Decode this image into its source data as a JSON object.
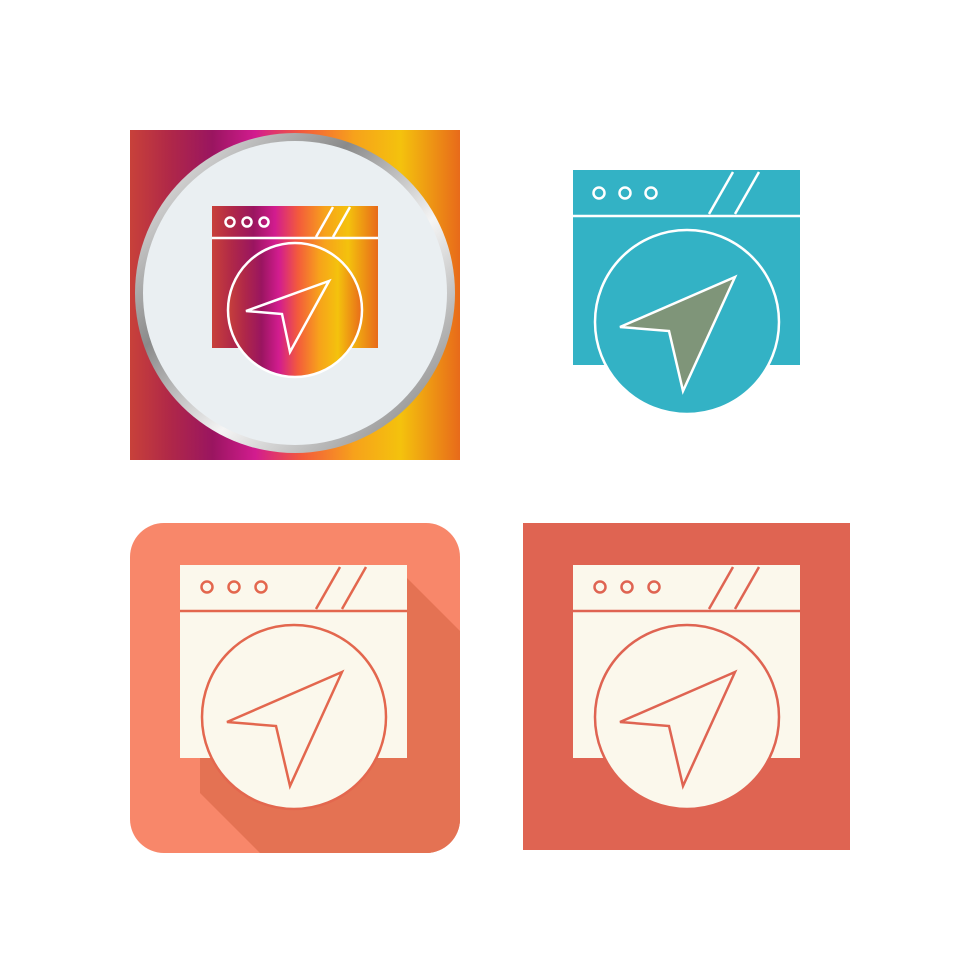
{
  "icons": [
    {
      "name": "browser-navigation-gradient-icon",
      "style": "gradient-circle",
      "colors": {
        "stops": [
          "#c8413a",
          "#9a1560",
          "#d21c8f",
          "#f35a3c",
          "#f7a21b",
          "#f4c20d",
          "#e86a1a"
        ],
        "ring": "#9a9a9a",
        "inner_background": "#eaeff2",
        "stroke": "#ffffff"
      }
    },
    {
      "name": "browser-navigation-glyph-icon",
      "style": "glyph",
      "colors": {
        "body": "#33b2c5",
        "arrow": "#7f9579",
        "stroke": "#ffffff"
      }
    },
    {
      "name": "browser-navigation-rounded-icon",
      "style": "rounded-long-shadow",
      "colors": {
        "background": "#f8876a",
        "shadow": "#e47253",
        "foreground": "#fbf8ec",
        "stroke": "#e3674e"
      }
    },
    {
      "name": "browser-navigation-flat-icon",
      "style": "flat-square",
      "colors": {
        "background": "#df6452",
        "foreground": "#fbf8ec",
        "stroke": "#df6452"
      }
    }
  ]
}
